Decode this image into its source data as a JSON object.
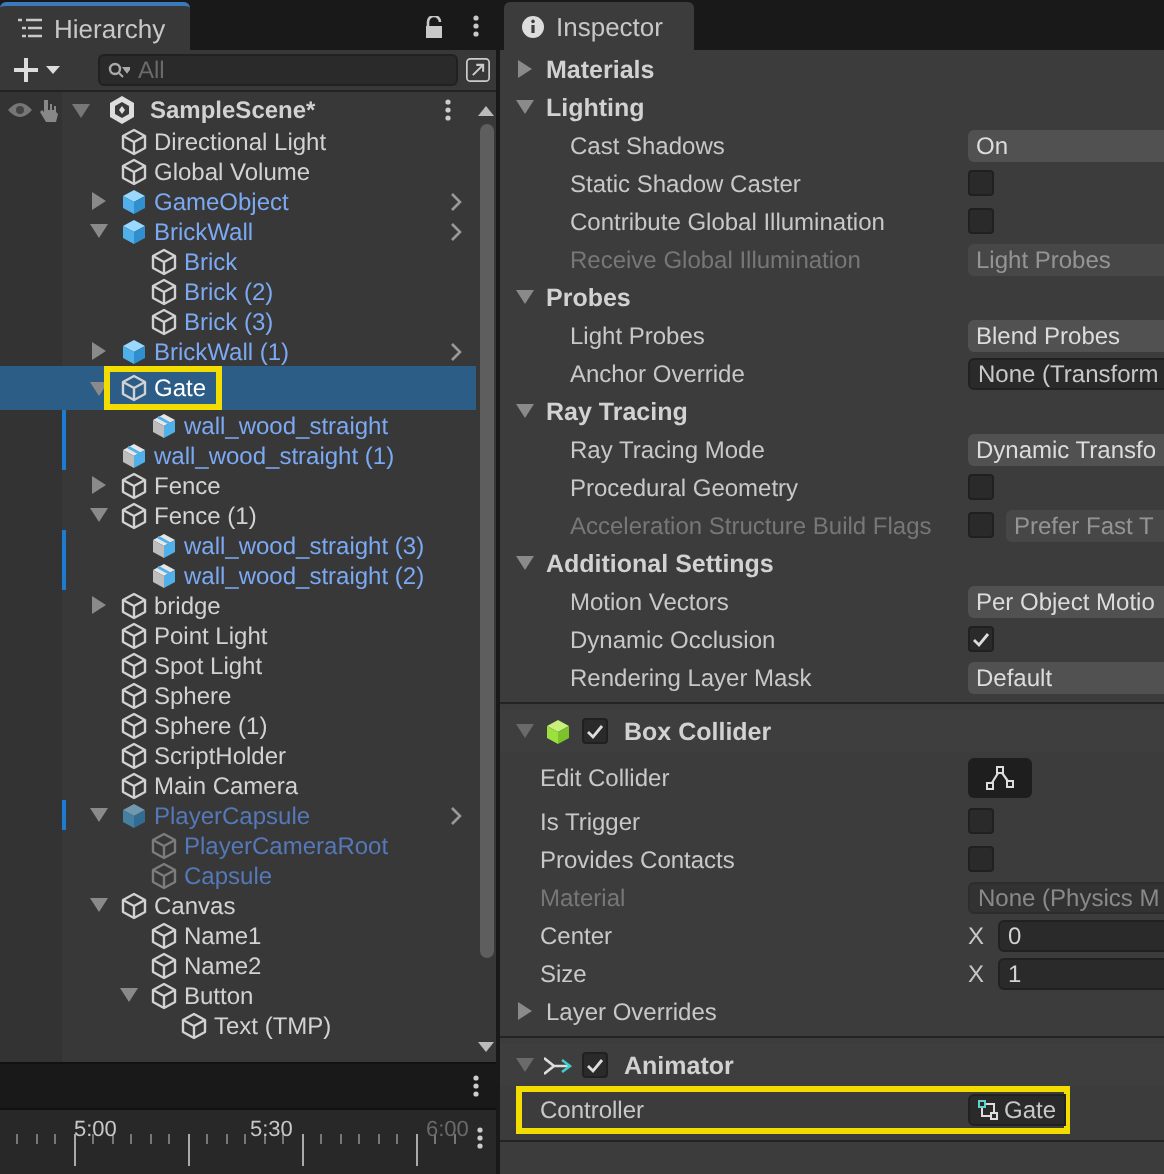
{
  "hierarchy": {
    "title": "Hierarchy",
    "search": {
      "placeholder": "All"
    },
    "scene": {
      "label": "SampleScene*",
      "expanded": true,
      "children": [
        {
          "label": "Directional Light",
          "kind": "object",
          "modified": false,
          "selected": false,
          "highlighted": false
        },
        {
          "label": "Global Volume",
          "kind": "object",
          "modified": false,
          "selected": false,
          "highlighted": false
        },
        {
          "label": "GameObject",
          "kind": "prefab",
          "expanded": false,
          "modified": false,
          "selected": false,
          "highlighted": false
        },
        {
          "label": "BrickWall",
          "kind": "prefab",
          "expanded": true,
          "modified": false,
          "selected": false,
          "highlighted": false,
          "children": [
            {
              "label": "Brick",
              "kind": "prefab-part",
              "modified": false,
              "selected": false,
              "highlighted": false
            },
            {
              "label": "Brick (2)",
              "kind": "prefab-part",
              "modified": false,
              "selected": false,
              "highlighted": false
            },
            {
              "label": "Brick (3)",
              "kind": "prefab-part",
              "modified": false,
              "selected": false,
              "highlighted": false
            }
          ]
        },
        {
          "label": "BrickWall (1)",
          "kind": "prefab",
          "expanded": false,
          "modified": false,
          "selected": false,
          "highlighted": false
        },
        {
          "label": "Gate",
          "kind": "object",
          "expanded": true,
          "modified": false,
          "selected": true,
          "highlighted": true,
          "children": [
            {
              "label": "wall_wood_straight",
              "kind": "model",
              "modified": true,
              "selected": false,
              "highlighted": false
            }
          ]
        },
        {
          "label": "wall_wood_straight (1)",
          "kind": "model",
          "modified": true,
          "selected": false,
          "highlighted": false
        },
        {
          "label": "Fence",
          "kind": "object",
          "expanded": false,
          "modified": false,
          "selected": false,
          "highlighted": false
        },
        {
          "label": "Fence (1)",
          "kind": "object",
          "expanded": true,
          "modified": false,
          "selected": false,
          "highlighted": false,
          "children": [
            {
              "label": "wall_wood_straight (3)",
              "kind": "model",
              "modified": true,
              "selected": false,
              "highlighted": false
            },
            {
              "label": "wall_wood_straight (2)",
              "kind": "model",
              "modified": true,
              "selected": false,
              "highlighted": false
            }
          ]
        },
        {
          "label": "bridge",
          "kind": "object",
          "expanded": false,
          "modified": false,
          "selected": false,
          "highlighted": false
        },
        {
          "label": "Point Light",
          "kind": "object",
          "modified": false,
          "selected": false,
          "highlighted": false
        },
        {
          "label": "Spot Light",
          "kind": "object",
          "modified": false,
          "selected": false,
          "highlighted": false
        },
        {
          "label": "Sphere",
          "kind": "object",
          "modified": false,
          "selected": false,
          "highlighted": false
        },
        {
          "label": "Sphere (1)",
          "kind": "object",
          "modified": false,
          "selected": false,
          "highlighted": false
        },
        {
          "label": "ScriptHolder",
          "kind": "object",
          "modified": false,
          "selected": false,
          "highlighted": false
        },
        {
          "label": "Main Camera",
          "kind": "object",
          "modified": false,
          "selected": false,
          "highlighted": false
        },
        {
          "label": "PlayerCapsule",
          "kind": "inactive-prefab",
          "expanded": true,
          "modified": true,
          "selected": false,
          "highlighted": false,
          "children": [
            {
              "label": "PlayerCameraRoot",
              "kind": "inactive-part",
              "modified": false,
              "selected": false,
              "highlighted": false
            },
            {
              "label": "Capsule",
              "kind": "inactive-part",
              "modified": false,
              "selected": false,
              "highlighted": false
            }
          ]
        },
        {
          "label": "Canvas",
          "kind": "object",
          "expanded": true,
          "modified": false,
          "selected": false,
          "highlighted": false,
          "children": [
            {
              "label": "Name1",
              "kind": "object",
              "modified": false,
              "selected": false,
              "highlighted": false
            },
            {
              "label": "Name2",
              "kind": "object",
              "modified": false,
              "selected": false,
              "highlighted": false
            },
            {
              "label": "Button",
              "kind": "object",
              "expanded": true,
              "modified": false,
              "selected": false,
              "highlighted": false,
              "children": [
                {
                  "label": "Text (TMP)",
                  "kind": "object",
                  "modified": false,
                  "selected": false,
                  "highlighted": false
                }
              ]
            }
          ]
        }
      ]
    }
  },
  "timeline": {
    "marks": [
      {
        "label": "5:00",
        "dimmed": false
      },
      {
        "label": "5:30",
        "dimmed": false
      },
      {
        "label": "6:00",
        "dimmed": true
      }
    ]
  },
  "inspector": {
    "title": "Inspector",
    "sections": [
      {
        "kind": "foldout",
        "title": "Materials",
        "expanded": false
      },
      {
        "kind": "foldout",
        "title": "Lighting",
        "expanded": true,
        "rows": [
          {
            "kind": "dropdown",
            "label": "Cast Shadows",
            "value": "On",
            "disabled": false
          },
          {
            "kind": "checkbox",
            "label": "Static Shadow Caster",
            "checked": false,
            "disabled": false
          },
          {
            "kind": "checkbox",
            "label": "Contribute Global Illumination",
            "checked": false,
            "disabled": false
          },
          {
            "kind": "dropdown",
            "label": "Receive Global Illumination",
            "value": "Light Probes",
            "disabled": true
          }
        ]
      },
      {
        "kind": "foldout",
        "title": "Probes",
        "expanded": true,
        "rows": [
          {
            "kind": "dropdown",
            "label": "Light Probes",
            "value": "Blend Probes",
            "disabled": false
          },
          {
            "kind": "object",
            "label": "Anchor Override",
            "value": "None (Transform",
            "disabled": false
          }
        ]
      },
      {
        "kind": "foldout",
        "title": "Ray Tracing",
        "expanded": true,
        "rows": [
          {
            "kind": "dropdown",
            "label": "Ray Tracing Mode",
            "value": "Dynamic Transfo",
            "disabled": false
          },
          {
            "kind": "checkbox",
            "label": "Procedural Geometry",
            "checked": false,
            "disabled": false
          },
          {
            "kind": "checkbox-dropdown",
            "label": "Acceleration Structure Build Flags",
            "checked": false,
            "value": "Prefer Fast T",
            "disabled": true
          }
        ]
      },
      {
        "kind": "foldout",
        "title": "Additional Settings",
        "expanded": true,
        "rows": [
          {
            "kind": "dropdown",
            "label": "Motion Vectors",
            "value": "Per Object Motio",
            "disabled": false
          },
          {
            "kind": "checkbox",
            "label": "Dynamic Occlusion",
            "checked": true,
            "disabled": false
          },
          {
            "kind": "dropdown",
            "label": "Rendering Layer Mask",
            "value": "Default",
            "disabled": false
          }
        ]
      },
      {
        "kind": "box-collider",
        "title": "Box Collider",
        "enabled": true,
        "expanded": true,
        "rows": [
          {
            "kind": "button",
            "label": "Edit Collider",
            "disabled": false
          },
          {
            "kind": "checkbox",
            "label": "Is Trigger",
            "checked": false,
            "disabled": false
          },
          {
            "kind": "checkbox",
            "label": "Provides Contacts",
            "checked": false,
            "disabled": false
          },
          {
            "kind": "object",
            "label": "Material",
            "value": "None (Physics M",
            "disabled": true
          },
          {
            "kind": "vector",
            "label": "Center",
            "axis": "X",
            "value": "0",
            "disabled": false
          },
          {
            "kind": "vector",
            "label": "Size",
            "axis": "X",
            "value": "1",
            "disabled": false
          },
          {
            "kind": "foldout",
            "label": "Layer Overrides",
            "expanded": false,
            "disabled": false
          }
        ]
      },
      {
        "kind": "animator",
        "title": "Animator",
        "enabled": true,
        "expanded": true,
        "rows": [
          {
            "kind": "asset",
            "label": "Controller",
            "value": "Gate",
            "disabled": false,
            "highlighted": true
          }
        ]
      }
    ]
  }
}
